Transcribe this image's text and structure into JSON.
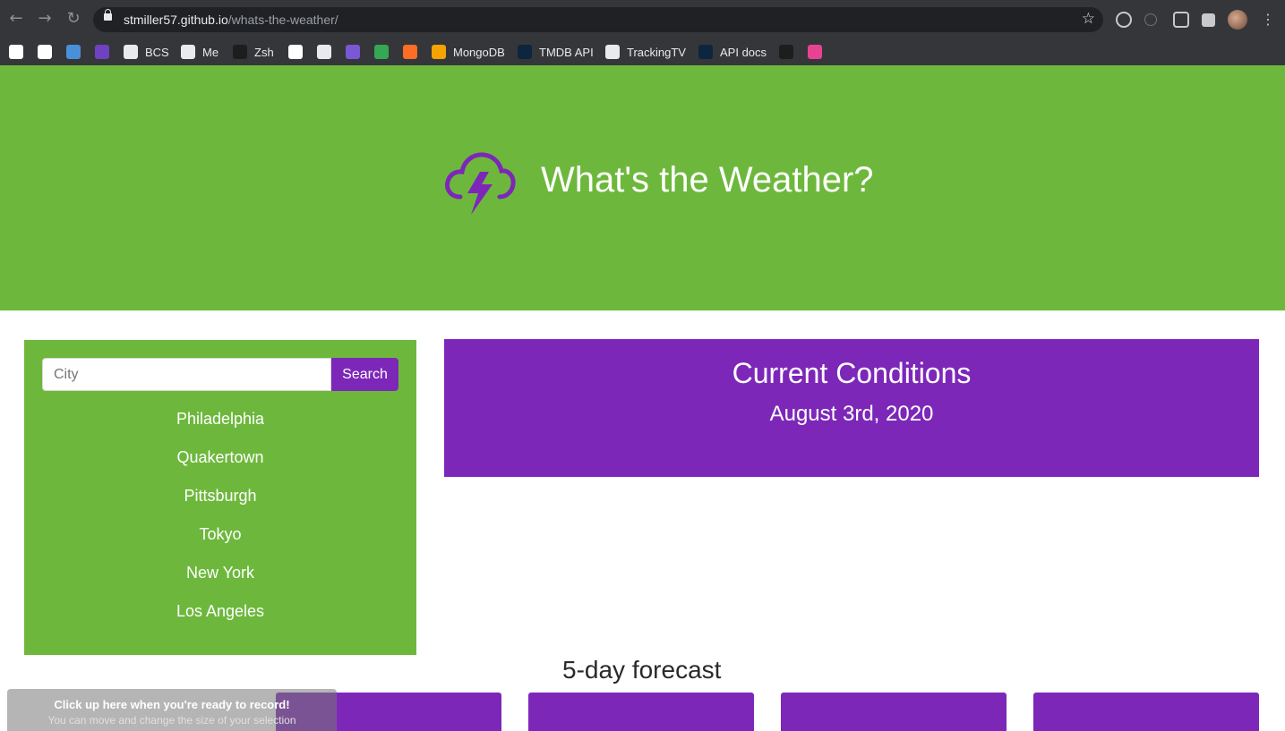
{
  "browser": {
    "url_host": "stmiller57.github.io",
    "url_path": "/whats-the-weather/",
    "bookmarks": [
      {
        "label": "",
        "icon": "amazon-icon",
        "color": "#ffffff"
      },
      {
        "label": "",
        "icon": "r-icon",
        "color": "#ffffff"
      },
      {
        "label": "",
        "icon": "cloud-icon",
        "color": "#4a90d9"
      },
      {
        "label": "",
        "icon": "b-icon",
        "color": "#6f42c1"
      },
      {
        "label": "BCS",
        "icon": "globe-icon",
        "color": "#e8eaed"
      },
      {
        "label": "Me",
        "icon": "github-icon",
        "color": "#e8eaed"
      },
      {
        "label": "Zsh",
        "icon": "code-icon",
        "color": "#1d1d1d"
      },
      {
        "label": "",
        "icon": "ex-icon",
        "color": "#ffffff"
      },
      {
        "label": "",
        "icon": "cs-icon",
        "color": "#e8eaed"
      },
      {
        "label": "",
        "icon": "h-icon",
        "color": "#7957d5"
      },
      {
        "label": "",
        "icon": "drive-icon",
        "color": "#34a853"
      },
      {
        "label": "",
        "icon": "gitlab-icon",
        "color": "#fc6d26"
      },
      {
        "label": "MongoDB",
        "icon": "mongodb-icon",
        "color": "#f4a300"
      },
      {
        "label": "TMDB API",
        "icon": "tmdb-icon",
        "color": "#0d253f"
      },
      {
        "label": "TrackingTV",
        "icon": "github-icon",
        "color": "#e8eaed"
      },
      {
        "label": "API docs",
        "icon": "tmdb-icon",
        "color": "#0d253f"
      },
      {
        "label": "",
        "icon": "acrobat-icon",
        "color": "#1d1d1d"
      },
      {
        "label": "",
        "icon": "hexagon-icon",
        "color": "#e84393"
      },
      {
        "label": "",
        "icon": "alien-icon",
        "color": "#35363a"
      }
    ]
  },
  "hero": {
    "title": "What's the Weather?",
    "icon": "thunderstorm-icon",
    "color": "#6db83c"
  },
  "search": {
    "placeholder": "City",
    "button_label": "Search"
  },
  "cities": [
    "Philadelphia",
    "Quakertown",
    "Pittsburgh",
    "Tokyo",
    "New York",
    "Los Angeles"
  ],
  "current": {
    "title": "Current Conditions",
    "date": "August 3rd, 2020",
    "color": "#7d27b9"
  },
  "forecast": {
    "heading": "5-day forecast"
  },
  "recorder": {
    "title": "Click up here when you're ready to record!",
    "subtitle": "You can move and change the size of your selection"
  }
}
